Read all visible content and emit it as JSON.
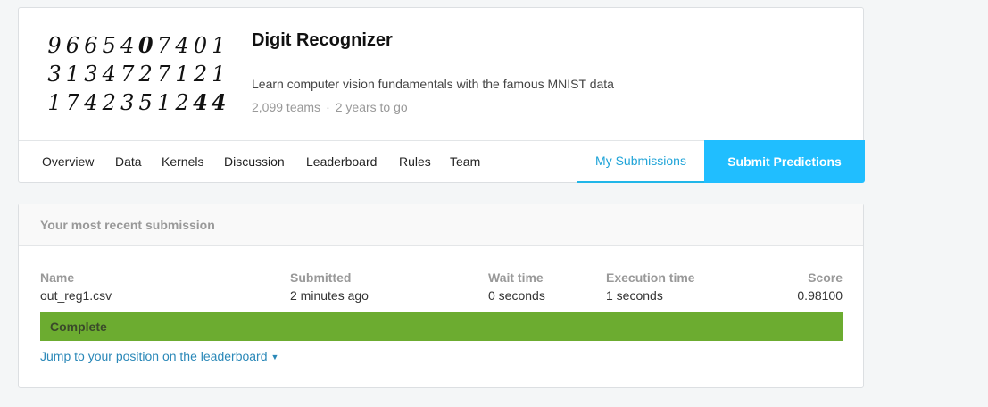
{
  "competition": {
    "title": "Digit Recognizer",
    "subtitle": "Learn computer vision fundamentals with the famous MNIST data",
    "teams": "2,099 teams",
    "separator": "·",
    "deadline": "2 years to go",
    "thumbnail_rows": [
      [
        "9",
        "6",
        "6",
        "5",
        "4",
        "0",
        "7",
        "4",
        "0",
        "1"
      ],
      [
        "3",
        "1",
        "3",
        "4",
        "7",
        "2",
        "7",
        "1",
        "2",
        "1"
      ],
      [
        "1",
        "7",
        "4",
        "2",
        "3",
        "5",
        "1",
        "2",
        "4",
        "4"
      ]
    ]
  },
  "nav": {
    "tabs": [
      "Overview",
      "Data",
      "Kernels",
      "Discussion",
      "Leaderboard",
      "Rules",
      "Team"
    ],
    "my_submissions": "My Submissions",
    "submit_predictions": "Submit Predictions"
  },
  "recent": {
    "heading": "Your most recent submission",
    "columns": {
      "name": {
        "label": "Name",
        "value": "out_reg1.csv"
      },
      "submitted": {
        "label": "Submitted",
        "value": "2 minutes ago"
      },
      "wait": {
        "label": "Wait time",
        "value": "0 seconds"
      },
      "execution": {
        "label": "Execution time",
        "value": "1 seconds"
      },
      "score": {
        "label": "Score",
        "value": "0.98100"
      }
    },
    "status": "Complete",
    "jump_link": "Jump to your position on the leaderboard",
    "colors": {
      "status_bg": "#6cac30",
      "accent": "#20beff",
      "link": "#2a88b8"
    }
  }
}
